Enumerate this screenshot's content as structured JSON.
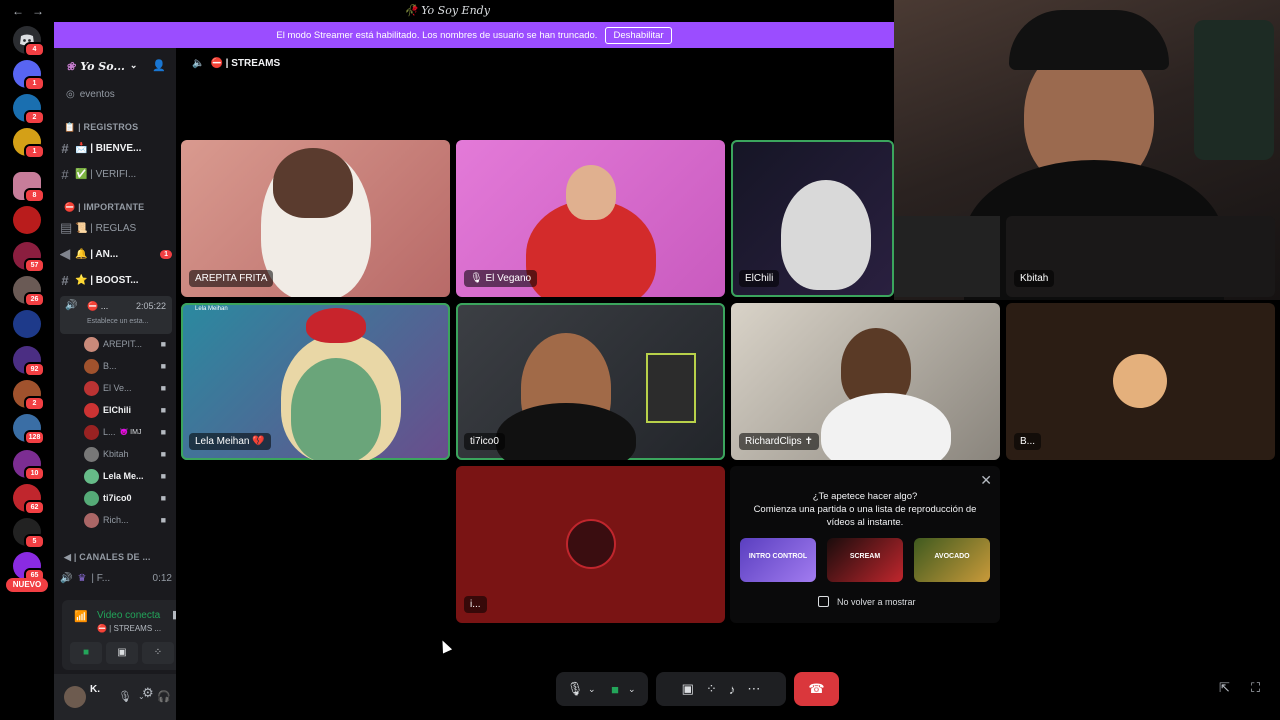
{
  "window": {
    "title": "🥀 Yo Soy Endy",
    "nav": "←→"
  },
  "banner": {
    "message": "El modo Streamer está habilitado. Los nombres de usuario se han truncado.",
    "button": "Deshabilitar"
  },
  "rail": {
    "badges": [
      "4",
      "1",
      "2",
      "1",
      "8",
      "",
      "57",
      "26",
      "",
      "92",
      "2",
      "128",
      "10",
      "62",
      "5",
      "65"
    ],
    "new_label": "NUEVO"
  },
  "sidebar": {
    "guild_name": "Yo So...",
    "events": "eventos",
    "cat_registros": "📋 | REGISTROS",
    "bienvenida": "📩 | BIENVE...",
    "verificacion": "✅ | VERIFI...",
    "cat_importante": "| IMPORTANTE",
    "reglas": "📜 | REGLAS",
    "anuncios": "🔔 | AN...",
    "anuncios_badge": "1",
    "boost": "⭐ | BOOST...",
    "active_voice": {
      "name": "⛔ ...",
      "time": "2:05:22",
      "status": "Establece un esta..."
    },
    "members": [
      {
        "name": "AREPIT...",
        "color": "#c98a7a"
      },
      {
        "name": "B...",
        "color": "#a0522d"
      },
      {
        "name": "El Ve...",
        "color": "#b33"
      },
      {
        "name": "ElChili",
        "color": "#c33"
      },
      {
        "name": "L...",
        "color": "#922",
        "extra": "👿 IMJ"
      },
      {
        "name": "Kbitah",
        "color": "#777"
      },
      {
        "name": "Lela Me...",
        "color": "#6b8"
      },
      {
        "name": "ti7ico0",
        "color": "#5a7"
      },
      {
        "name": "Rich...",
        "color": "#a66"
      }
    ],
    "cat_canales": "| CANALES DE ...",
    "voice2": {
      "name": "| F...",
      "time": "0:12"
    }
  },
  "voice_panel": {
    "connected": "Video conecta",
    "channel": "⛔ | STREAMS ..."
  },
  "user": {
    "name": "K."
  },
  "main": {
    "channel": "⛔ | STREAMS"
  },
  "tiles": [
    {
      "name": "AREPITA FRITA"
    },
    {
      "name": "🎙 El Vegano"
    },
    {
      "name": "ElChili"
    },
    {
      "name": "Kbitah"
    },
    {
      "name": "Lela Meihan 💔",
      "overlay": "Lela Meihan"
    },
    {
      "name": "ti7ico0"
    },
    {
      "name": "RichardClips ✝"
    },
    {
      "name": "B..."
    },
    {
      "name": "i..."
    }
  ],
  "activity": {
    "question": "¿Te apetece hacer algo?",
    "subtitle": "Comienza una partida o una lista de reproducción de vídeos al instante.",
    "games": [
      "INTRO CONTROL",
      "SCREAM",
      "AVOCADO"
    ],
    "dont_show": "No volver a mostrar"
  },
  "colors": {
    "accent": "#9b4dff",
    "speaking": "#3ba55d",
    "hangup": "#da373c"
  }
}
